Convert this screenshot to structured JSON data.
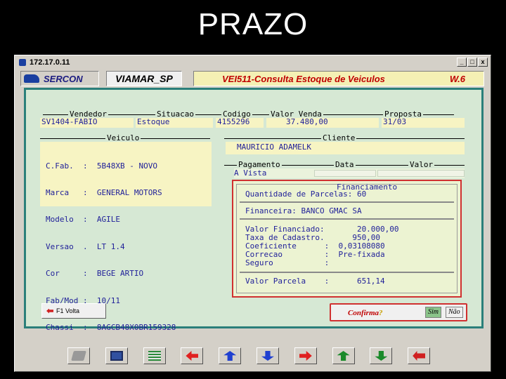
{
  "slide": {
    "title": "PRAZO"
  },
  "window": {
    "title": "172.17.0.11",
    "min": "_",
    "max": "□",
    "close": "x"
  },
  "header": {
    "brand": "SERCON",
    "store": "VIAMAR_SP",
    "module": "VEI511-Consulta Estoque de Veiculos",
    "version": "W.6"
  },
  "top_section": {
    "vendedor_label": "Vendedor",
    "situacao_label": "Situacao",
    "codigo_label": "Codigo",
    "valor_venda_label": "Valor Venda",
    "proposta_label": "Proposta",
    "vendedor": "SV1404-FABIO",
    "situacao": "Estoque",
    "codigo": "4155296",
    "valor_venda": "37.480,00",
    "proposta": "31/03"
  },
  "veiculo": {
    "label": "Veiculo",
    "rows": [
      "C.Fab.  :  5B48XB - NOVO",
      "Marca   :  GENERAL MOTORS",
      "Modelo  :  AGILE",
      "Versao  .  LT 1.4",
      "Cor     :  BEGE ARTIO",
      "Fab/Mod :  10/11",
      "Chassi  :  8AGCB48X0BR159328"
    ]
  },
  "cliente": {
    "label": "Cliente",
    "name": "MAURICIO ADAMELK"
  },
  "pagamento": {
    "label": "Pagamento",
    "data_label": "Data",
    "valor_label": "Valor",
    "row": "A Vista"
  },
  "financiamento": {
    "label": "Financiamento",
    "parcelas": "Quantidade de Parcelas: 60",
    "financeira": "Financeira: BANCO GMAC SA",
    "valor_financiado": "Valor Financiado:       20.000,00",
    "taxa_cadastro": "Taxa de Cadastro.      950,00",
    "coeficiente": "Coeficiente      :  0,03108080",
    "correcao": "Correcao         :  Pre-fixada",
    "seguro": "Seguro           :",
    "valor_parcela": "Valor Parcela    :      651,14"
  },
  "actions": {
    "back": "F1 Volta",
    "confirm": "Confirma",
    "confirm_q": "?",
    "yes": "Sim",
    "no": "Não"
  },
  "toolbar_icons": [
    "printer-icon",
    "calculator-icon",
    "list-icon",
    "arrow-left-icon",
    "arrow-up-icon",
    "arrow-down-icon",
    "arrow-right-icon",
    "upload-icon",
    "download-icon",
    "exit-icon"
  ],
  "colors": {
    "panel_border": "#2b7f7a",
    "field_bg": "#f7f4c3",
    "panel_bg": "#d6e8d4",
    "accent_red": "#d03030"
  }
}
